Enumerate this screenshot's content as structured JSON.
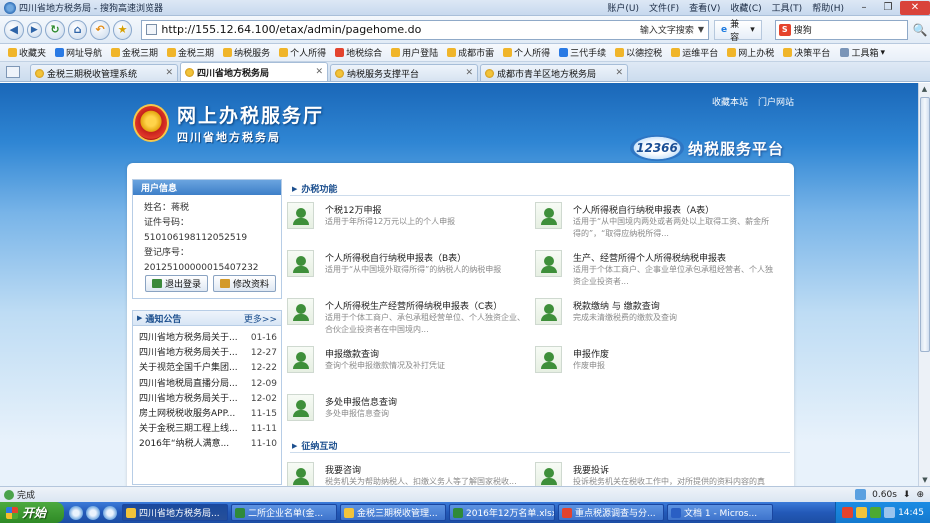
{
  "window": {
    "title": "四川省地方税务局 - 搜狗高速浏览器",
    "menus": [
      "账户(U)",
      "文件(F)",
      "查看(V)",
      "收藏(C)",
      "工具(T)",
      "帮助(H)"
    ]
  },
  "address": {
    "url": "http://155.12.64.100/etax/admin/pagehome.do",
    "hint": "输入文字搜索",
    "compat_label": "兼容",
    "search_value": "搜狗"
  },
  "favorites": [
    {
      "label": "收藏夹",
      "color": "#f0b52a"
    },
    {
      "label": "网址导航",
      "color": "#2a7ae4"
    },
    {
      "label": "金税三期",
      "color": "#f0b52a"
    },
    {
      "label": "金税三期",
      "color": "#f0b52a"
    },
    {
      "label": "纳税服务",
      "color": "#f0b52a"
    },
    {
      "label": "个人所得",
      "color": "#f0b52a"
    },
    {
      "label": "地税综合",
      "color": "#e3432e"
    },
    {
      "label": "用户登陆",
      "color": "#f0b52a"
    },
    {
      "label": "成都市雷",
      "color": "#f0b52a"
    },
    {
      "label": "个人所得",
      "color": "#f0b52a"
    },
    {
      "label": "三代手续",
      "color": "#2a7ae4"
    },
    {
      "label": "以德控税",
      "color": "#f0b52a"
    },
    {
      "label": "运维平台",
      "color": "#f0b52a"
    },
    {
      "label": "网上办税",
      "color": "#f0b52a"
    },
    {
      "label": "决策平台",
      "color": "#f0b52a"
    }
  ],
  "tools_label": "工具箱",
  "tabs": [
    {
      "label": "金税三期税收管理系统",
      "active": false
    },
    {
      "label": "四川省地方税务局",
      "active": true
    },
    {
      "label": "纳税服务支撑平台",
      "active": false
    },
    {
      "label": "成都市青羊区地方税务局",
      "active": false
    }
  ],
  "header": {
    "links": [
      "收藏本站",
      "门户网站"
    ],
    "logo_title": "网上办税服务厅",
    "logo_subtitle": "四川省地方税务局",
    "platform_badge": "12366",
    "platform_text": "纳税服务平台"
  },
  "user": {
    "head": "用户信息",
    "name_line": "姓名：蒋税",
    "cert_line": "证件号码：510106198112052519",
    "reg_label": "登记序号：",
    "reg_value": "20125100000015407232",
    "logout_label": "退出登录",
    "edit_label": "修改资料"
  },
  "notices": {
    "head": "通知公告",
    "more": "更多>>",
    "items": [
      {
        "title": "四川省地方税务局关于...",
        "date": "01-16"
      },
      {
        "title": "四川省地方税务局关于...",
        "date": "12-27"
      },
      {
        "title": "关于视范全国千户集团...",
        "date": "12-22"
      },
      {
        "title": "四川省地税局直播分局...",
        "date": "12-09"
      },
      {
        "title": "四川省地方税务局关于...",
        "date": "12-02"
      },
      {
        "title": "房土网税税收服务APP...",
        "date": "11-15"
      },
      {
        "title": "关于金税三期工程上线...",
        "date": "11-11"
      },
      {
        "title": "2016年“纳税人满意...",
        "date": "11-10"
      }
    ]
  },
  "sections": {
    "tax_functions": "办税功能",
    "interaction": "征纳互动"
  },
  "functions": [
    {
      "title": "个税12万申报",
      "desc": "适用于年所得12万元以上的个人申报"
    },
    {
      "title": "个人所得税自行纳税申报表（A表）",
      "desc": "适用于“从中国境内两处或者两处以上取得工资、薪金所得的”，“取得应纳税所得..."
    },
    {
      "title": "个人所得税自行纳税申报表（B表）",
      "desc": "适用于“从中国境外取得所得”的纳税人的纳税申报"
    },
    {
      "title": "生产、经营所得个人所得税纳税申报表",
      "desc": "适用于个体工商户、企事业单位承包承租经营者、个人独资企业投资者..."
    },
    {
      "title": "个人所得税生产经营所得纳税申报表（C表）",
      "desc": "适用于个体工商户、承包承租经营单位、个人独资企业、合伙企业投资者在中国境内..."
    },
    {
      "title": "税款缴纳 与 缴款查询",
      "desc": "完成未清缴税费的缴款及查询"
    },
    {
      "title": "申报缴款查询",
      "desc": "查询个税申报缴款情况及补打凭证"
    },
    {
      "title": "申报作废",
      "desc": "作废申报"
    },
    {
      "title": "多处申报信息查询",
      "desc": "多处申报信息查询"
    }
  ],
  "interactions": [
    {
      "title": "我要咨询",
      "desc": "税务机关为帮助纳税人、扣缴义务人等了解国家税收..."
    },
    {
      "title": "我要投诉",
      "desc": "投诉税务机关在税收工作中，对所提供的资料内容的真实..."
    }
  ],
  "status": {
    "text": "完成",
    "time": "0.60s"
  },
  "taskbar": {
    "start": "开始",
    "tasks": [
      "四川省地方税务局...",
      "二所企业名单(金...",
      "金税三期税收管理...",
      "2016年12万名单.xlsx",
      "重点税源调查与分...",
      "文档 1 - Micros..."
    ],
    "clock": "14:45"
  }
}
